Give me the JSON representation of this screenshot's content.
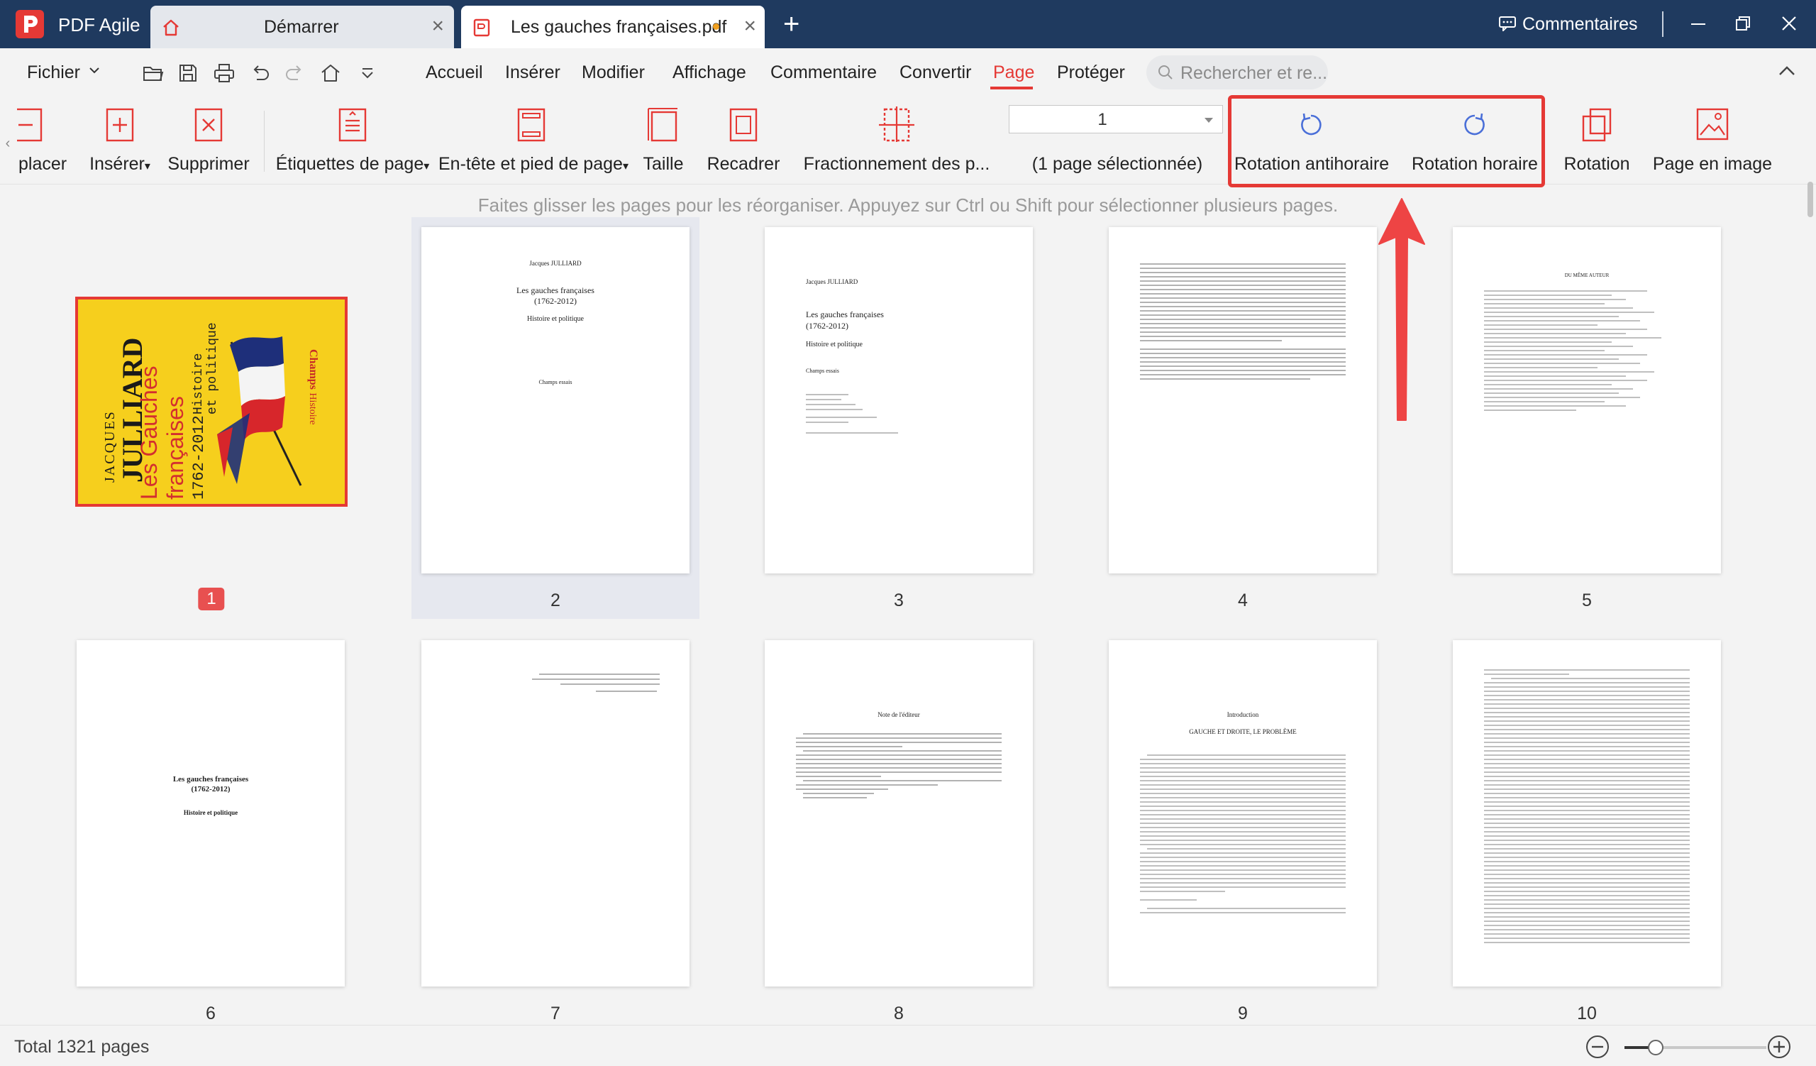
{
  "app": {
    "name": "PDF Agile",
    "tabs": [
      {
        "label": "Démarrer",
        "icon": "home-icon"
      },
      {
        "label": "Les gauches françaises.pdf",
        "icon": "pdf-file-icon",
        "unsaved": true
      }
    ],
    "comments_label": "Commentaires",
    "accent": "#e53935",
    "titlebar_color": "#1f3a5f"
  },
  "menu": {
    "file": "Fichier",
    "tabs": [
      "Accueil",
      "Insérer",
      "Modifier",
      "Affichage",
      "Commentaire",
      "Convertir",
      "Page",
      "Protéger"
    ],
    "active_tab": "Page",
    "search_placeholder": "Rechercher et re..."
  },
  "ribbon": {
    "move": "placer",
    "insert": "Insérer",
    "delete": "Supprimer",
    "page_labels": "Étiquettes de page",
    "header_footer": "En-tête et pied de page",
    "size": "Taille",
    "crop": "Recadrer",
    "split": "Fractionnement des p...",
    "page_select_value": "1",
    "selected_info": "(1 page sélectionnée)",
    "rotate_ccw": "Rotation antihoraire",
    "rotate_cw": "Rotation horaire",
    "rotation": "Rotation",
    "page_to_image": "Page en image"
  },
  "hint": "Faites glisser les pages pour les réorganiser. Appuyez sur Ctrl ou Shift pour sélectionner plusieurs pages.",
  "pages": [
    {
      "num": "1",
      "selected": true
    },
    {
      "num": "2",
      "author": "Jacques JULLIARD",
      "title": "Les gauches françaises",
      "years": "(1762-2012)",
      "subtitle": "Histoire et politique",
      "collection": "Champs essais"
    },
    {
      "num": "3",
      "author": "Jacques JULLIARD",
      "title": "Les gauches françaises",
      "years": "(1762-2012)",
      "subtitle": "Histoire et politique",
      "collection": "Champs essais"
    },
    {
      "num": "4"
    },
    {
      "num": "5",
      "heading": "DU MÊME AUTEUR"
    },
    {
      "num": "6",
      "title": "Les gauches françaises",
      "years": "(1762-2012)",
      "subtitle": "Histoire et politique"
    },
    {
      "num": "7"
    },
    {
      "num": "8",
      "heading": "Note de l'éditeur"
    },
    {
      "num": "9",
      "heading": "Introduction",
      "subheading": "GAUCHE ET DROITE, LE PROBLÈME"
    },
    {
      "num": "10"
    }
  ],
  "cover": {
    "author_first": "JACQUES",
    "author_last": "JULLIARD",
    "title_line1": "Les Gauches",
    "title_line2": "françaises",
    "years": "1762-2012",
    "subtitle_line1": "Histoire",
    "subtitle_line2": "et politique",
    "publisher": "Champs",
    "publisher_sub": "Histoire"
  },
  "status": {
    "total": "Total 1321 pages",
    "zoom_fraction": 0.22
  }
}
